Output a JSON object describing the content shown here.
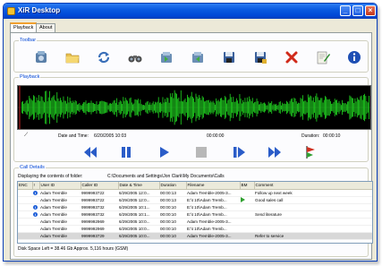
{
  "window": {
    "title": "XiR Desktop",
    "minimize_glyph": "_",
    "maximize_glyph": "□",
    "close_glyph": "×"
  },
  "tabs": [
    {
      "label": "Playback",
      "active": true
    },
    {
      "label": "About",
      "active": false
    }
  ],
  "toolbar": {
    "label": "Toolbar",
    "tools": [
      {
        "icon": "server-icon"
      },
      {
        "icon": "folder-icon"
      },
      {
        "icon": "refresh-icon"
      },
      {
        "icon": "binoculars-icon"
      },
      {
        "icon": "import-icon"
      },
      {
        "icon": "export-icon"
      },
      {
        "icon": "save-icon"
      },
      {
        "icon": "save-as-icon"
      },
      {
        "icon": "delete-icon"
      },
      {
        "icon": "notes-icon"
      },
      {
        "icon": "info-icon"
      }
    ]
  },
  "playback": {
    "label": "Playback",
    "date_time_label": "Date and Time:",
    "date_time_value": "6/20/2005 10:03",
    "position_value": "00:00:00",
    "duration_label": "Duration:",
    "duration_value": "00:00:10",
    "waveform_color": "#22dd22",
    "controls": [
      {
        "icon": "rewind-icon"
      },
      {
        "icon": "pause-icon"
      },
      {
        "icon": "play-icon"
      },
      {
        "icon": "stop-icon"
      },
      {
        "icon": "step-forward-icon"
      },
      {
        "icon": "fast-forward-icon"
      },
      {
        "icon": "flag-icon"
      }
    ]
  },
  "call_details": {
    "label": "Call Details",
    "folder_label": "Displaying the contents of folder:",
    "folder_path": "C:\\Documents and Settings\\Jon Clark\\My Documents\\Calls",
    "columns": [
      "ENC",
      "!",
      "User ID",
      "Caller ID",
      "Date & Time",
      "Duration",
      "Filename",
      "BM",
      "Comment"
    ],
    "rows": [
      {
        "enc": "",
        "flag": "info",
        "user": "Adam Tremble",
        "caller": "9999993722",
        "datetime": "6/29/2005 12:0...",
        "duration": "00:00:13",
        "filename": "Adam Tremble-2005-3...",
        "bm": "",
        "comment": "Follow up next week"
      },
      {
        "enc": "",
        "flag": "",
        "user": "Adam Tremble",
        "caller": "9999993722",
        "datetime": "6/29/2005 12:0...",
        "duration": "00:00:13",
        "filename": "E:\\t 10\\Adam Tremb...",
        "bm": "play",
        "comment": "Good sales call"
      },
      {
        "enc": "",
        "flag": "info",
        "user": "Adam Tremble",
        "caller": "9999993732",
        "datetime": "6/29/2005 10:1...",
        "duration": "00:00:10",
        "filename": "E:\\t 10\\Adam Tremb...",
        "bm": "",
        "comment": ""
      },
      {
        "enc": "",
        "flag": "info",
        "user": "Adam Tremble",
        "caller": "9999993732",
        "datetime": "6/29/2005 10:1...",
        "duration": "00:00:10",
        "filename": "E:\\t 10\\Adam Tremb...",
        "bm": "",
        "comment": "Send literature"
      },
      {
        "enc": "",
        "flag": "",
        "user": "Adam Tremble",
        "caller": "9999992969",
        "datetime": "6/29/2005 10:0...",
        "duration": "00:00:10",
        "filename": "Adam Tremble-2005-3...",
        "bm": "",
        "comment": ""
      },
      {
        "enc": "",
        "flag": "",
        "user": "Adam Tremble",
        "caller": "9999992969",
        "datetime": "6/29/2005 10:0...",
        "duration": "00:00:10",
        "filename": "E:\\t 10\\Adam Tremb...",
        "bm": "",
        "comment": ""
      },
      {
        "enc": "",
        "flag": "",
        "user": "Adam Tremble",
        "caller": "9999993729",
        "datetime": "6/29/2005 10:0...",
        "duration": "00:00:10",
        "filename": "Adam Tremble-2005-3...",
        "bm": "",
        "comment": "Refer to service"
      }
    ],
    "selected_row": 6,
    "disk_space": "Disk Space Left = 38.46 Gb  Approx. 5,116 hours (GSM)"
  }
}
